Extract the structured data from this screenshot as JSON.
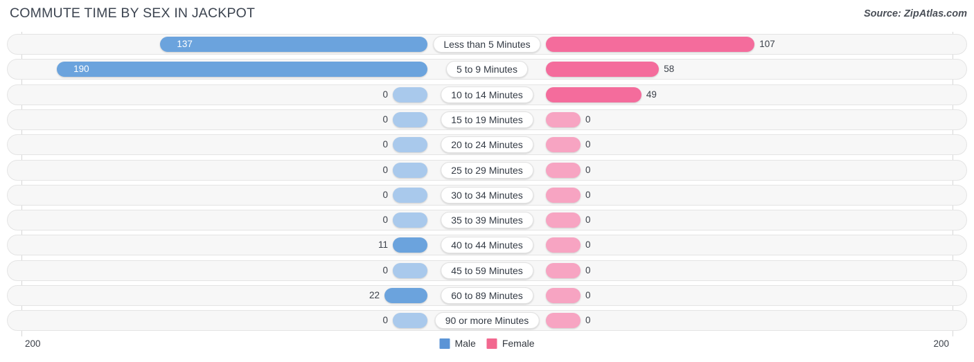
{
  "header": {
    "title": "COMMUTE TIME BY SEX IN JACKPOT",
    "source": "Source: ZipAtlas.com"
  },
  "legend": {
    "items": [
      {
        "label": "Male",
        "color": "#5b94d6"
      },
      {
        "label": "Female",
        "color": "#f2688f"
      }
    ]
  },
  "axis": {
    "left_tick": "200",
    "right_tick": "200",
    "max": 200
  },
  "colors": {
    "male": "#6ba3dd",
    "male_zero": "#a9c9ec",
    "female": "#f46c9c",
    "female_zero": "#f7a4c2",
    "row_bg": "#f7f7f7",
    "row_border": "#e4e4e4",
    "axis_line": "#d6d6d6",
    "text": "#3b4049"
  },
  "chart_data": {
    "type": "bar",
    "title": "COMMUTE TIME BY SEX IN JACKPOT",
    "subtitle": "Source: ZipAtlas.com",
    "orientation": "horizontal-diverging",
    "xlabel": "",
    "ylabel": "",
    "xlim": [
      -200,
      200
    ],
    "axis_tick_labels": [
      "200",
      "200"
    ],
    "grid": false,
    "legend_position": "bottom-center",
    "categories": [
      "Less than 5 Minutes",
      "5 to 9 Minutes",
      "10 to 14 Minutes",
      "15 to 19 Minutes",
      "20 to 24 Minutes",
      "25 to 29 Minutes",
      "30 to 34 Minutes",
      "35 to 39 Minutes",
      "40 to 44 Minutes",
      "45 to 59 Minutes",
      "60 to 89 Minutes",
      "90 or more Minutes"
    ],
    "series": [
      {
        "name": "Male",
        "values": [
          137,
          190,
          0,
          0,
          0,
          0,
          0,
          0,
          11,
          0,
          22,
          0
        ]
      },
      {
        "name": "Female",
        "values": [
          107,
          58,
          49,
          0,
          0,
          0,
          0,
          0,
          0,
          0,
          0,
          0
        ]
      }
    ]
  },
  "rows": [
    {
      "category": "Less than 5 Minutes",
      "male": "137",
      "female": "107"
    },
    {
      "category": "5 to 9 Minutes",
      "male": "190",
      "female": "58"
    },
    {
      "category": "10 to 14 Minutes",
      "male": "0",
      "female": "49"
    },
    {
      "category": "15 to 19 Minutes",
      "male": "0",
      "female": "0"
    },
    {
      "category": "20 to 24 Minutes",
      "male": "0",
      "female": "0"
    },
    {
      "category": "25 to 29 Minutes",
      "male": "0",
      "female": "0"
    },
    {
      "category": "30 to 34 Minutes",
      "male": "0",
      "female": "0"
    },
    {
      "category": "35 to 39 Minutes",
      "male": "0",
      "female": "0"
    },
    {
      "category": "40 to 44 Minutes",
      "male": "11",
      "female": "0"
    },
    {
      "category": "45 to 59 Minutes",
      "male": "0",
      "female": "0"
    },
    {
      "category": "60 to 89 Minutes",
      "male": "22",
      "female": "0"
    },
    {
      "category": "90 or more Minutes",
      "male": "0",
      "female": "0"
    }
  ]
}
